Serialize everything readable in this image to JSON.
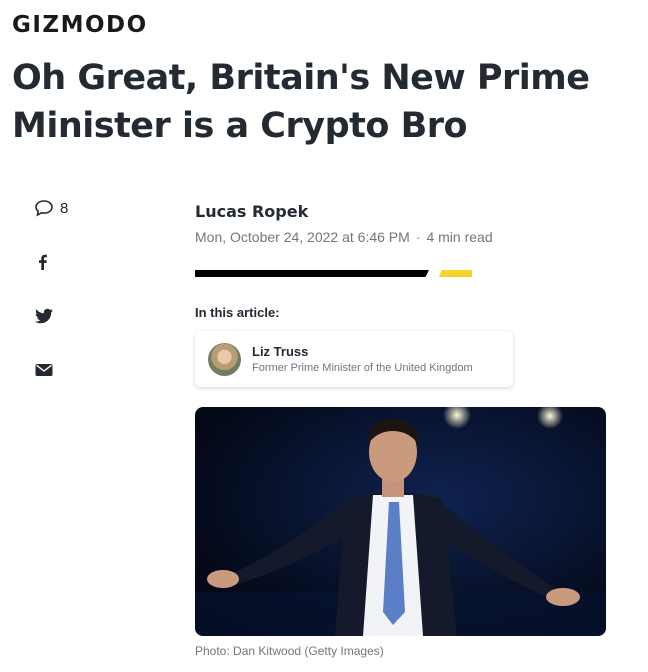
{
  "site": {
    "brand": "GIZMODO"
  },
  "article": {
    "headline": "Oh Great, Britain's New Prime Minister is a Crypto Bro",
    "author": "Lucas Ropek",
    "date": "Mon, October 24, 2022 at 6:46 PM",
    "separator": "·",
    "read_time": "4 min read",
    "in_this_article_label": "In this article:",
    "related_person": {
      "name": "Liz Truss",
      "description": "Former Prime Minister of the United Kingdom"
    },
    "photo_caption": "Photo: Dan Kitwood (Getty Images)"
  },
  "share": {
    "comment_count": "8",
    "icons": [
      "comment-icon",
      "facebook-icon",
      "twitter-icon",
      "email-icon"
    ]
  },
  "colors": {
    "accent_yellow": "#f6d52a",
    "headline": "#232a31",
    "meta": "#6e7780"
  }
}
